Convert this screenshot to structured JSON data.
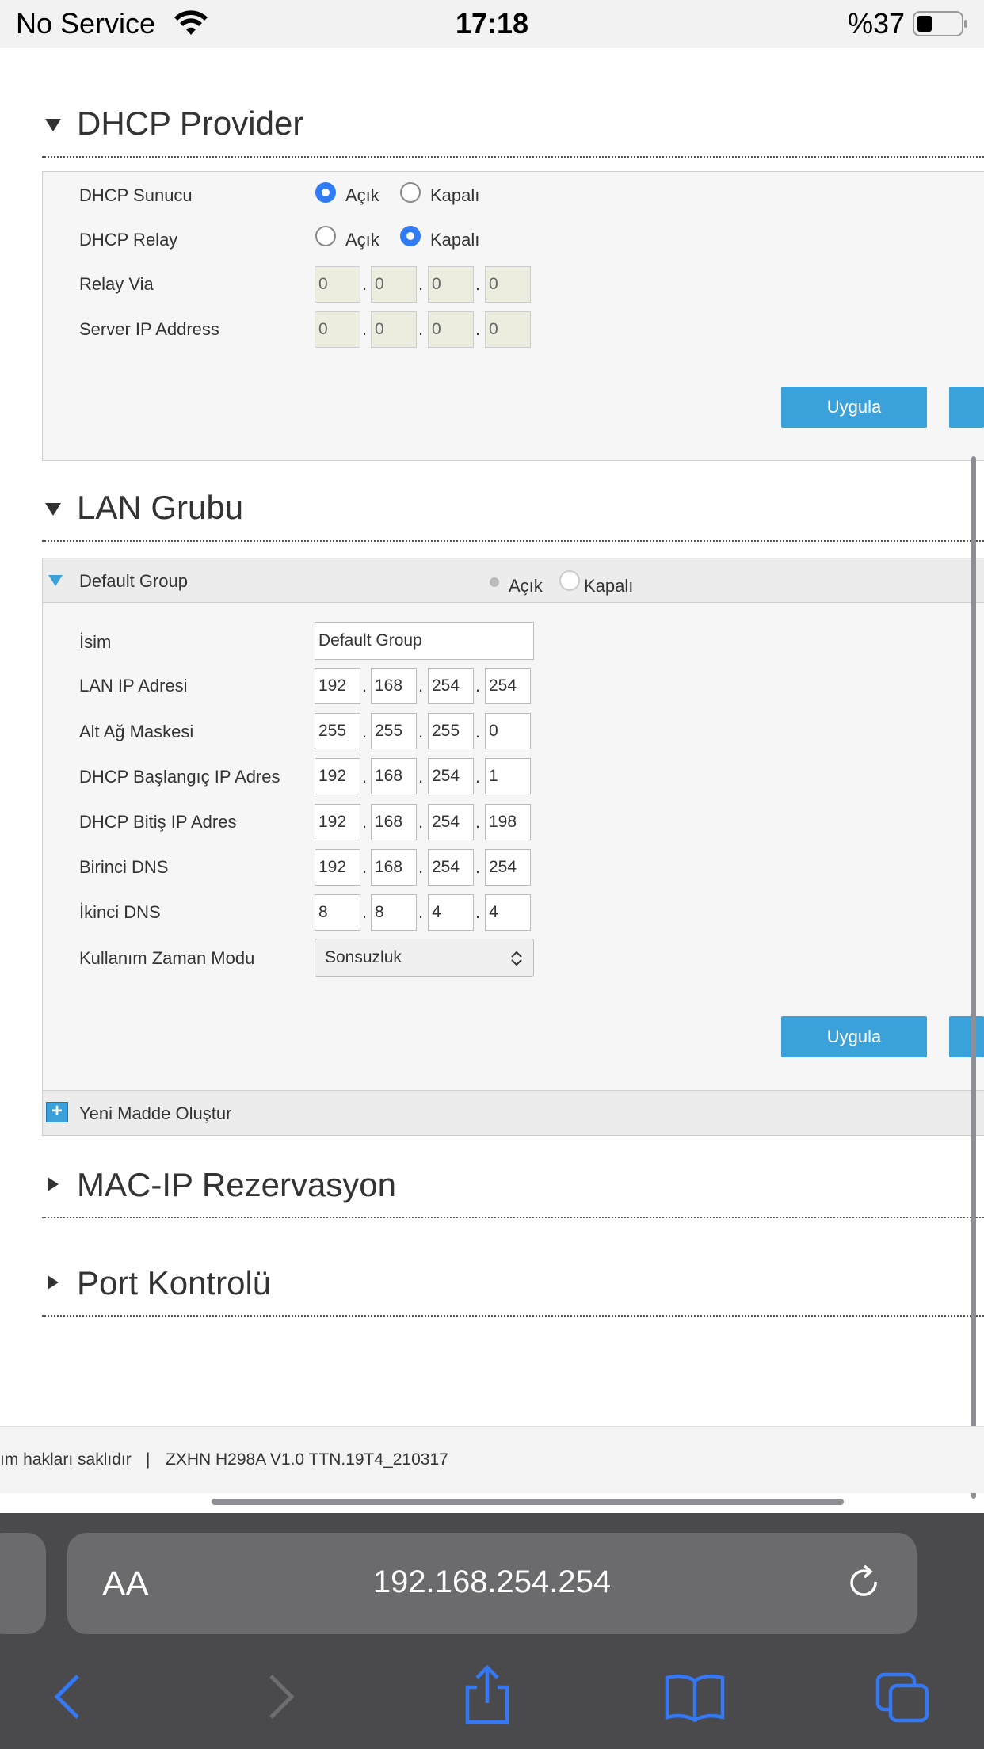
{
  "status_bar": {
    "carrier": "No Service",
    "time": "17:18",
    "battery": "%37"
  },
  "dhcp_provider": {
    "title": "DHCP Provider",
    "server": {
      "label": "DHCP Sunucu",
      "on": "Açık",
      "off": "Kapalı",
      "selected": "on"
    },
    "relay": {
      "label": "DHCP Relay",
      "on": "Açık",
      "off": "Kapalı",
      "selected": "off"
    },
    "relay_via": {
      "label": "Relay Via",
      "octets": [
        "0",
        "0",
        "0",
        "0"
      ]
    },
    "server_ip": {
      "label": "Server IP Address",
      "octets": [
        "0",
        "0",
        "0",
        "0"
      ]
    },
    "apply_label": "Uygula"
  },
  "lan_group": {
    "title": "LAN Grubu",
    "group": {
      "name": "Default Group",
      "on": "Açık",
      "off": "Kapalı"
    },
    "name_field": {
      "label": "İsim",
      "value": "Default Group"
    },
    "lan_ip": {
      "label": "LAN IP Adresi",
      "octets": [
        "192",
        "168",
        "254",
        "254"
      ]
    },
    "subnet": {
      "label": "Alt Ağ Maskesi",
      "octets": [
        "255",
        "255",
        "255",
        "0"
      ]
    },
    "dhcp_start": {
      "label": "DHCP Başlangıç IP Adres",
      "octets": [
        "192",
        "168",
        "254",
        "1"
      ]
    },
    "dhcp_end": {
      "label": "DHCP Bitiş IP Adres",
      "octets": [
        "192",
        "168",
        "254",
        "198"
      ]
    },
    "dns1": {
      "label": "Birinci DNS",
      "octets": [
        "192",
        "168",
        "254",
        "254"
      ]
    },
    "dns2": {
      "label": "İkinci DNS",
      "octets": [
        "8",
        "8",
        "4",
        "4"
      ]
    },
    "lease_mode": {
      "label": "Kullanım Zaman Modu",
      "value": "Sonsuzluk"
    },
    "apply_label": "Uygula",
    "new_item_label": "Yeni Madde Oluştur"
  },
  "mac_ip": {
    "title": "MAC-IP Rezervasyon"
  },
  "port_control": {
    "title": "Port Kontrolü"
  },
  "footer": {
    "copyright": "ım hakları saklıdır",
    "separator": "|",
    "version": "ZXHN H298A V1.0 TTN.19T4_210317"
  },
  "browser": {
    "aa_label": "AA",
    "url": "192.168.254.254"
  },
  "colors": {
    "accent": "#3ba1db",
    "radio": "#2f7cf6",
    "ios_blue": "#3478f6"
  }
}
